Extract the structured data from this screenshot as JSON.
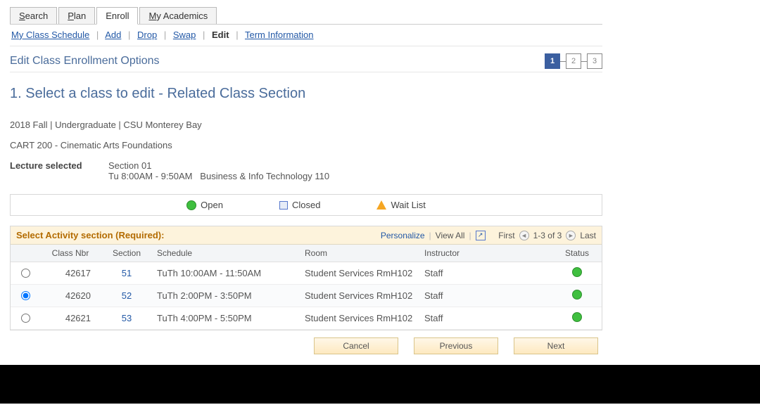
{
  "tabs": {
    "search": "Search",
    "plan": "Plan",
    "enroll": "Enroll",
    "academics": "My Academics"
  },
  "subnav": {
    "schedule": "My Class Schedule",
    "add": "Add",
    "drop": "Drop",
    "swap": "Swap",
    "edit": "Edit",
    "term": "Term Information"
  },
  "page_title": "Edit Class Enrollment Options",
  "steps": {
    "s1": "1",
    "s2": "2",
    "s3": "3"
  },
  "section_head": "1.  Select a class to edit - Related Class Section",
  "term_line": "2018 Fall | Undergraduate | CSU Monterey Bay",
  "course_line": "CART  200 - Cinematic Arts Foundations",
  "lecture": {
    "label": "Lecture selected",
    "section": "Section 01",
    "schedule": "Tu 8:00AM - 9:50AM   Business & Info Technology 110"
  },
  "legend": {
    "open": "Open",
    "closed": "Closed",
    "wait": "Wait List"
  },
  "grid": {
    "title": "Select Activity section (Required):",
    "personalize": "Personalize",
    "view_all": "View All",
    "first": "First",
    "range": "1-3 of 3",
    "last": "Last",
    "columns": {
      "class_nbr": "Class Nbr",
      "section": "Section",
      "schedule": "Schedule",
      "room": "Room",
      "instructor": "Instructor",
      "status": "Status"
    },
    "rows": [
      {
        "selected": false,
        "class_nbr": "42617",
        "section": "51",
        "schedule": "TuTh 10:00AM - 11:50AM",
        "room": "Student Services RmH102",
        "instructor": "Staff",
        "status": "open"
      },
      {
        "selected": true,
        "class_nbr": "42620",
        "section": "52",
        "schedule": "TuTh 2:00PM - 3:50PM",
        "room": "Student Services RmH102",
        "instructor": "Staff",
        "status": "open"
      },
      {
        "selected": false,
        "class_nbr": "42621",
        "section": "53",
        "schedule": "TuTh 4:00PM - 5:50PM",
        "room": "Student Services RmH102",
        "instructor": "Staff",
        "status": "open"
      }
    ]
  },
  "buttons": {
    "cancel": "Cancel",
    "previous": "Previous",
    "next": "Next"
  }
}
